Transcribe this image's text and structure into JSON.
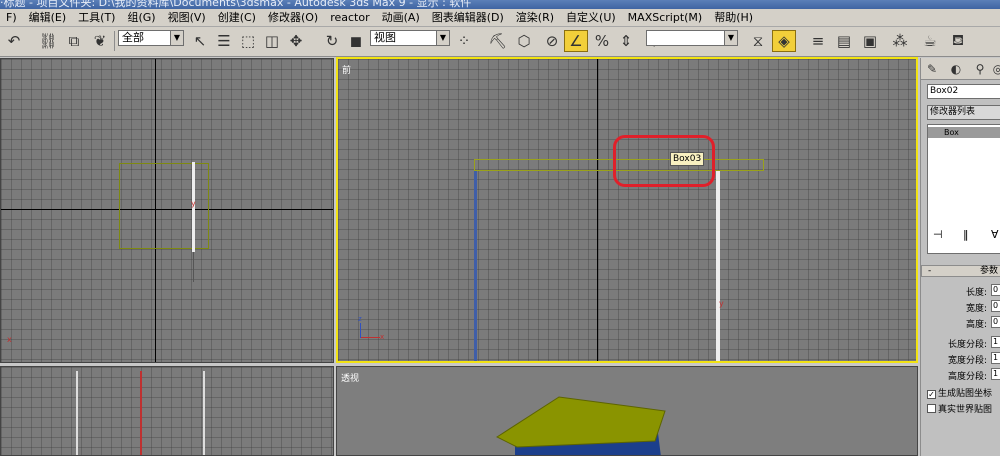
{
  "titlebar": {
    "text": "·标题 - 项目文件夹: D:\\我的资料库\\Documents\\3dsmax     - Autodesk 3ds Max 9     - 显示 : 软件"
  },
  "menu": [
    {
      "name": "menu-file-partial",
      "label": "F)"
    },
    {
      "name": "menu-edit",
      "label": "编辑(E)"
    },
    {
      "name": "menu-tools",
      "label": "工具(T)"
    },
    {
      "name": "menu-group",
      "label": "组(G)"
    },
    {
      "name": "menu-views",
      "label": "视图(V)"
    },
    {
      "name": "menu-create",
      "label": "创建(C)"
    },
    {
      "name": "menu-modifiers",
      "label": "修改器(O)"
    },
    {
      "name": "menu-reactor",
      "label": "reactor"
    },
    {
      "name": "menu-animation",
      "label": "动画(A)"
    },
    {
      "name": "menu-graph-editors",
      "label": "图表编辑器(D)"
    },
    {
      "name": "menu-rendering",
      "label": "渲染(R)"
    },
    {
      "name": "menu-customize",
      "label": "自定义(U)"
    },
    {
      "name": "menu-maxscript",
      "label": "MAXScript(M)"
    },
    {
      "name": "menu-help",
      "label": "帮助(H)"
    }
  ],
  "toolbar": {
    "selection_filter": "全部",
    "reference_coord": "视图",
    "named_selection": ""
  },
  "viewports": {
    "front": {
      "label": "前",
      "object_tooltip": "Box03",
      "axis_z": "z",
      "axis_x": "x",
      "axis_y": "y"
    },
    "top_left": {
      "axis_x": "x",
      "axis_y": "y"
    },
    "perspective": {
      "label": "透视"
    }
  },
  "panel": {
    "object_name": "Box02",
    "modifier_list": "修改器列表",
    "stack_item": "Box",
    "rollout_title": "参数",
    "params": [
      {
        "label": "长度:",
        "value": "0"
      },
      {
        "label": "宽度:",
        "value": "0"
      },
      {
        "label": "高度:",
        "value": "0"
      },
      {
        "label": "长度分段:",
        "value": "1"
      },
      {
        "label": "宽度分段:",
        "value": "1"
      },
      {
        "label": "高度分段:",
        "value": "1"
      }
    ],
    "checkboxes": [
      {
        "label": "生成贴图坐标",
        "checked": true
      },
      {
        "label": "真实世界贴图",
        "checked": false
      }
    ]
  },
  "colors": {
    "active_viewport_border": "#f2e312",
    "highlight_circle": "#e0202a",
    "box_yellow": "#8a9400",
    "box_blue": "#1c3f8c"
  }
}
